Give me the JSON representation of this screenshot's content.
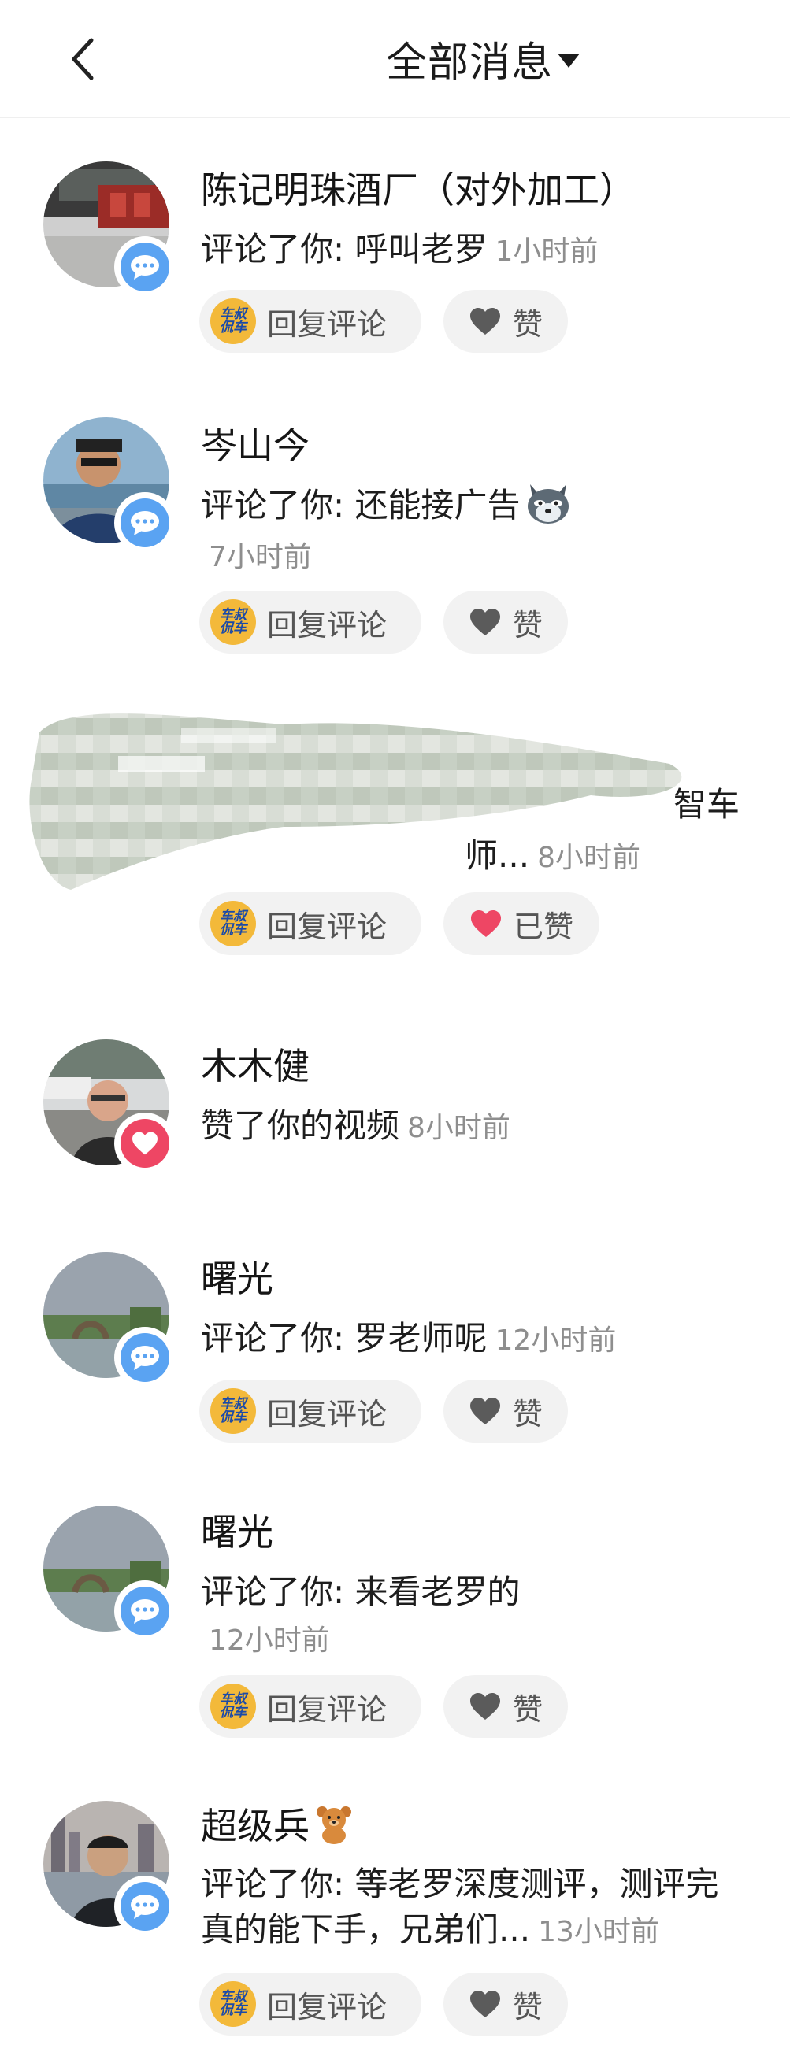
{
  "header": {
    "title": "全部消息",
    "back_icon": "chevron-left-icon",
    "dropdown_icon": "caret-down-icon"
  },
  "buttons": {
    "reply_label": "回复评论",
    "like_label": "赞",
    "liked_label": "已赞",
    "reply_logo_text": [
      "车叔",
      "侃车"
    ]
  },
  "colors": {
    "comment_badge": "#5aa3f2",
    "like_badge": "#ee4664",
    "liked_heart": "#ee4664",
    "heart_grey": "#5b5b5b"
  },
  "messages": [
    {
      "name": "陈记明珠酒厂（对外加工）",
      "text": "评论了你: 呼叫老罗",
      "time": "1小时前",
      "badge": "comment",
      "liked": false
    },
    {
      "name": "岑山今",
      "text": "评论了你: 还能接广告",
      "emoji": "wolf-emoji",
      "time": "7小时前",
      "badge": "comment",
      "liked": false
    },
    {
      "name": "",
      "text_fragment_1": "智车",
      "text_fragment_2": "师...",
      "time": "8小时前",
      "badge": "comment",
      "liked": true,
      "redacted": true
    },
    {
      "name": "木木健",
      "text": "赞了你的视频",
      "time": "8小时前",
      "badge": "like"
    },
    {
      "name": "曙光",
      "text": "评论了你: 罗老师呢",
      "time": "12小时前",
      "badge": "comment",
      "liked": false
    },
    {
      "name": "曙光",
      "text": "评论了你: 来看老罗的",
      "time": "12小时前",
      "badge": "comment",
      "liked": false
    },
    {
      "name": "超级兵",
      "name_emoji": "bear-emoji",
      "text_line1": "评论了你: 等老罗深度测评，测评完",
      "text_line2": "真的能下手，兄弟们...",
      "time": "13小时前",
      "badge": "comment",
      "liked": false
    }
  ]
}
